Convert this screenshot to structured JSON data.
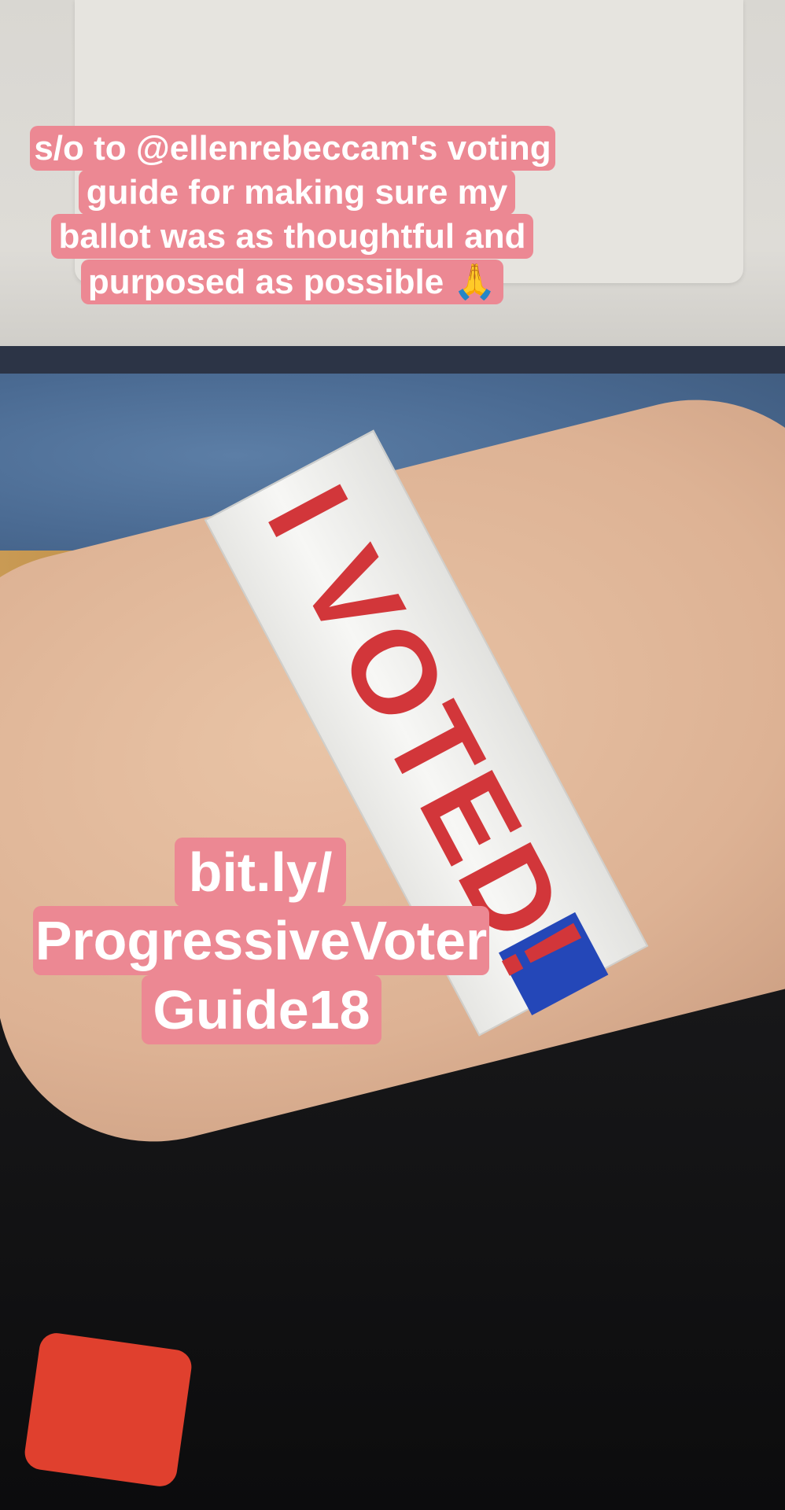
{
  "caption_top": {
    "lines": [
      "s/o to @ellenrebeccam's voting",
      "guide for making sure my",
      "ballot was as thoughtful and",
      "purposed as possible 🙏"
    ]
  },
  "caption_bottom": {
    "lines": [
      "bit.ly/",
      "ProgressiveVoter",
      "Guide18"
    ]
  },
  "wristband": {
    "text": "I VOTED!"
  },
  "colors": {
    "caption_bg": "#ec8893",
    "caption_text": "#ffffff",
    "wristband_text": "#d2363a"
  }
}
